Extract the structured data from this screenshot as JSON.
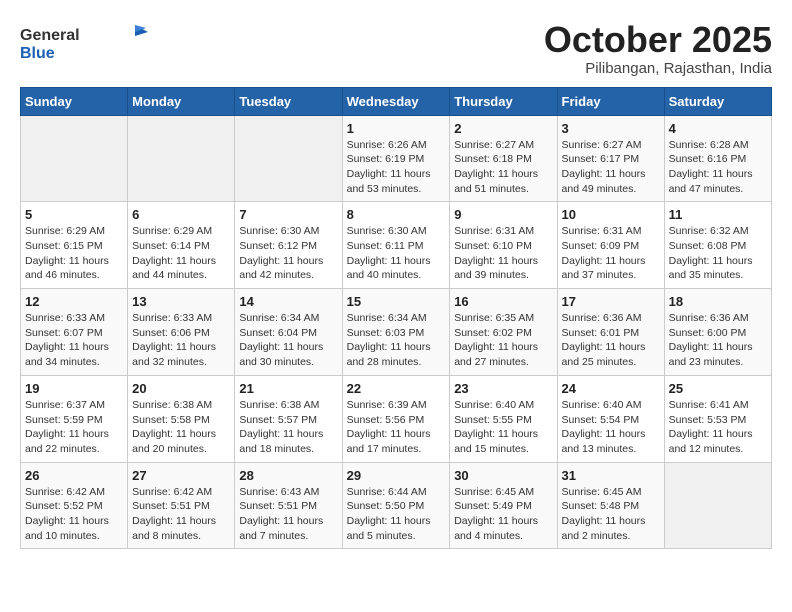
{
  "header": {
    "logo_general": "General",
    "logo_blue": "Blue",
    "month_title": "October 2025",
    "subtitle": "Pilibangan, Rajasthan, India"
  },
  "weekdays": [
    "Sunday",
    "Monday",
    "Tuesday",
    "Wednesday",
    "Thursday",
    "Friday",
    "Saturday"
  ],
  "weeks": [
    [
      {
        "day": "",
        "info": ""
      },
      {
        "day": "",
        "info": ""
      },
      {
        "day": "",
        "info": ""
      },
      {
        "day": "1",
        "info": "Sunrise: 6:26 AM\nSunset: 6:19 PM\nDaylight: 11 hours and 53 minutes."
      },
      {
        "day": "2",
        "info": "Sunrise: 6:27 AM\nSunset: 6:18 PM\nDaylight: 11 hours and 51 minutes."
      },
      {
        "day": "3",
        "info": "Sunrise: 6:27 AM\nSunset: 6:17 PM\nDaylight: 11 hours and 49 minutes."
      },
      {
        "day": "4",
        "info": "Sunrise: 6:28 AM\nSunset: 6:16 PM\nDaylight: 11 hours and 47 minutes."
      }
    ],
    [
      {
        "day": "5",
        "info": "Sunrise: 6:29 AM\nSunset: 6:15 PM\nDaylight: 11 hours and 46 minutes."
      },
      {
        "day": "6",
        "info": "Sunrise: 6:29 AM\nSunset: 6:14 PM\nDaylight: 11 hours and 44 minutes."
      },
      {
        "day": "7",
        "info": "Sunrise: 6:30 AM\nSunset: 6:12 PM\nDaylight: 11 hours and 42 minutes."
      },
      {
        "day": "8",
        "info": "Sunrise: 6:30 AM\nSunset: 6:11 PM\nDaylight: 11 hours and 40 minutes."
      },
      {
        "day": "9",
        "info": "Sunrise: 6:31 AM\nSunset: 6:10 PM\nDaylight: 11 hours and 39 minutes."
      },
      {
        "day": "10",
        "info": "Sunrise: 6:31 AM\nSunset: 6:09 PM\nDaylight: 11 hours and 37 minutes."
      },
      {
        "day": "11",
        "info": "Sunrise: 6:32 AM\nSunset: 6:08 PM\nDaylight: 11 hours and 35 minutes."
      }
    ],
    [
      {
        "day": "12",
        "info": "Sunrise: 6:33 AM\nSunset: 6:07 PM\nDaylight: 11 hours and 34 minutes."
      },
      {
        "day": "13",
        "info": "Sunrise: 6:33 AM\nSunset: 6:06 PM\nDaylight: 11 hours and 32 minutes."
      },
      {
        "day": "14",
        "info": "Sunrise: 6:34 AM\nSunset: 6:04 PM\nDaylight: 11 hours and 30 minutes."
      },
      {
        "day": "15",
        "info": "Sunrise: 6:34 AM\nSunset: 6:03 PM\nDaylight: 11 hours and 28 minutes."
      },
      {
        "day": "16",
        "info": "Sunrise: 6:35 AM\nSunset: 6:02 PM\nDaylight: 11 hours and 27 minutes."
      },
      {
        "day": "17",
        "info": "Sunrise: 6:36 AM\nSunset: 6:01 PM\nDaylight: 11 hours and 25 minutes."
      },
      {
        "day": "18",
        "info": "Sunrise: 6:36 AM\nSunset: 6:00 PM\nDaylight: 11 hours and 23 minutes."
      }
    ],
    [
      {
        "day": "19",
        "info": "Sunrise: 6:37 AM\nSunset: 5:59 PM\nDaylight: 11 hours and 22 minutes."
      },
      {
        "day": "20",
        "info": "Sunrise: 6:38 AM\nSunset: 5:58 PM\nDaylight: 11 hours and 20 minutes."
      },
      {
        "day": "21",
        "info": "Sunrise: 6:38 AM\nSunset: 5:57 PM\nDaylight: 11 hours and 18 minutes."
      },
      {
        "day": "22",
        "info": "Sunrise: 6:39 AM\nSunset: 5:56 PM\nDaylight: 11 hours and 17 minutes."
      },
      {
        "day": "23",
        "info": "Sunrise: 6:40 AM\nSunset: 5:55 PM\nDaylight: 11 hours and 15 minutes."
      },
      {
        "day": "24",
        "info": "Sunrise: 6:40 AM\nSunset: 5:54 PM\nDaylight: 11 hours and 13 minutes."
      },
      {
        "day": "25",
        "info": "Sunrise: 6:41 AM\nSunset: 5:53 PM\nDaylight: 11 hours and 12 minutes."
      }
    ],
    [
      {
        "day": "26",
        "info": "Sunrise: 6:42 AM\nSunset: 5:52 PM\nDaylight: 11 hours and 10 minutes."
      },
      {
        "day": "27",
        "info": "Sunrise: 6:42 AM\nSunset: 5:51 PM\nDaylight: 11 hours and 8 minutes."
      },
      {
        "day": "28",
        "info": "Sunrise: 6:43 AM\nSunset: 5:51 PM\nDaylight: 11 hours and 7 minutes."
      },
      {
        "day": "29",
        "info": "Sunrise: 6:44 AM\nSunset: 5:50 PM\nDaylight: 11 hours and 5 minutes."
      },
      {
        "day": "30",
        "info": "Sunrise: 6:45 AM\nSunset: 5:49 PM\nDaylight: 11 hours and 4 minutes."
      },
      {
        "day": "31",
        "info": "Sunrise: 6:45 AM\nSunset: 5:48 PM\nDaylight: 11 hours and 2 minutes."
      },
      {
        "day": "",
        "info": ""
      }
    ]
  ]
}
